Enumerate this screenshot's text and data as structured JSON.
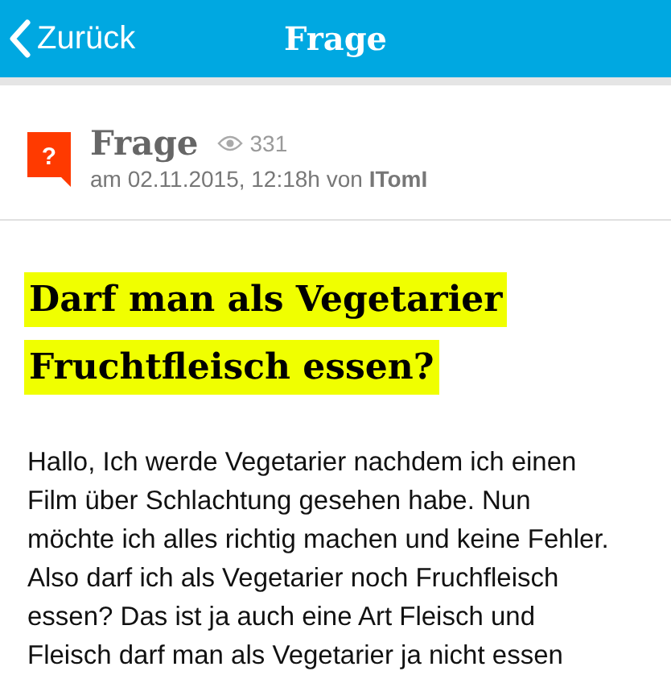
{
  "nav_bar": {
    "back_label": "Zurück",
    "title": "Frage"
  },
  "post_header": {
    "icon_glyph": "?",
    "type_label": "Frage",
    "views": "331",
    "meta": "am 02.11.2015, 12:18h von **ITomI**"
  },
  "question": {
    "title": "Darf man als Vegetarier Fruchtfleisch essen?",
    "body": "Hallo, Ich werde Vegetarier nachdem ich einen Film über Schlachtung gesehen habe. Nun möchte ich alles richtig machen und keine Fehler. Also darf ich als Vegetarier noch Fruchfleisch essen? Das ist ja auch eine Art Fleisch und Fleisch darf man als Vegetarier ja nicht essen"
  }
}
